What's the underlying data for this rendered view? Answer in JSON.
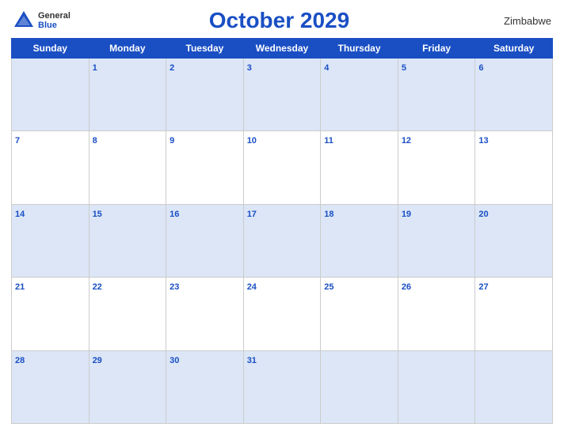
{
  "header": {
    "logo_general": "General",
    "logo_blue": "Blue",
    "title": "October 2029",
    "country": "Zimbabwe"
  },
  "days_of_week": [
    "Sunday",
    "Monday",
    "Tuesday",
    "Wednesday",
    "Thursday",
    "Friday",
    "Saturday"
  ],
  "weeks": [
    [
      null,
      1,
      2,
      3,
      4,
      5,
      6
    ],
    [
      7,
      8,
      9,
      10,
      11,
      12,
      13
    ],
    [
      14,
      15,
      16,
      17,
      18,
      19,
      20
    ],
    [
      21,
      22,
      23,
      24,
      25,
      26,
      27
    ],
    [
      28,
      29,
      30,
      31,
      null,
      null,
      null
    ]
  ]
}
